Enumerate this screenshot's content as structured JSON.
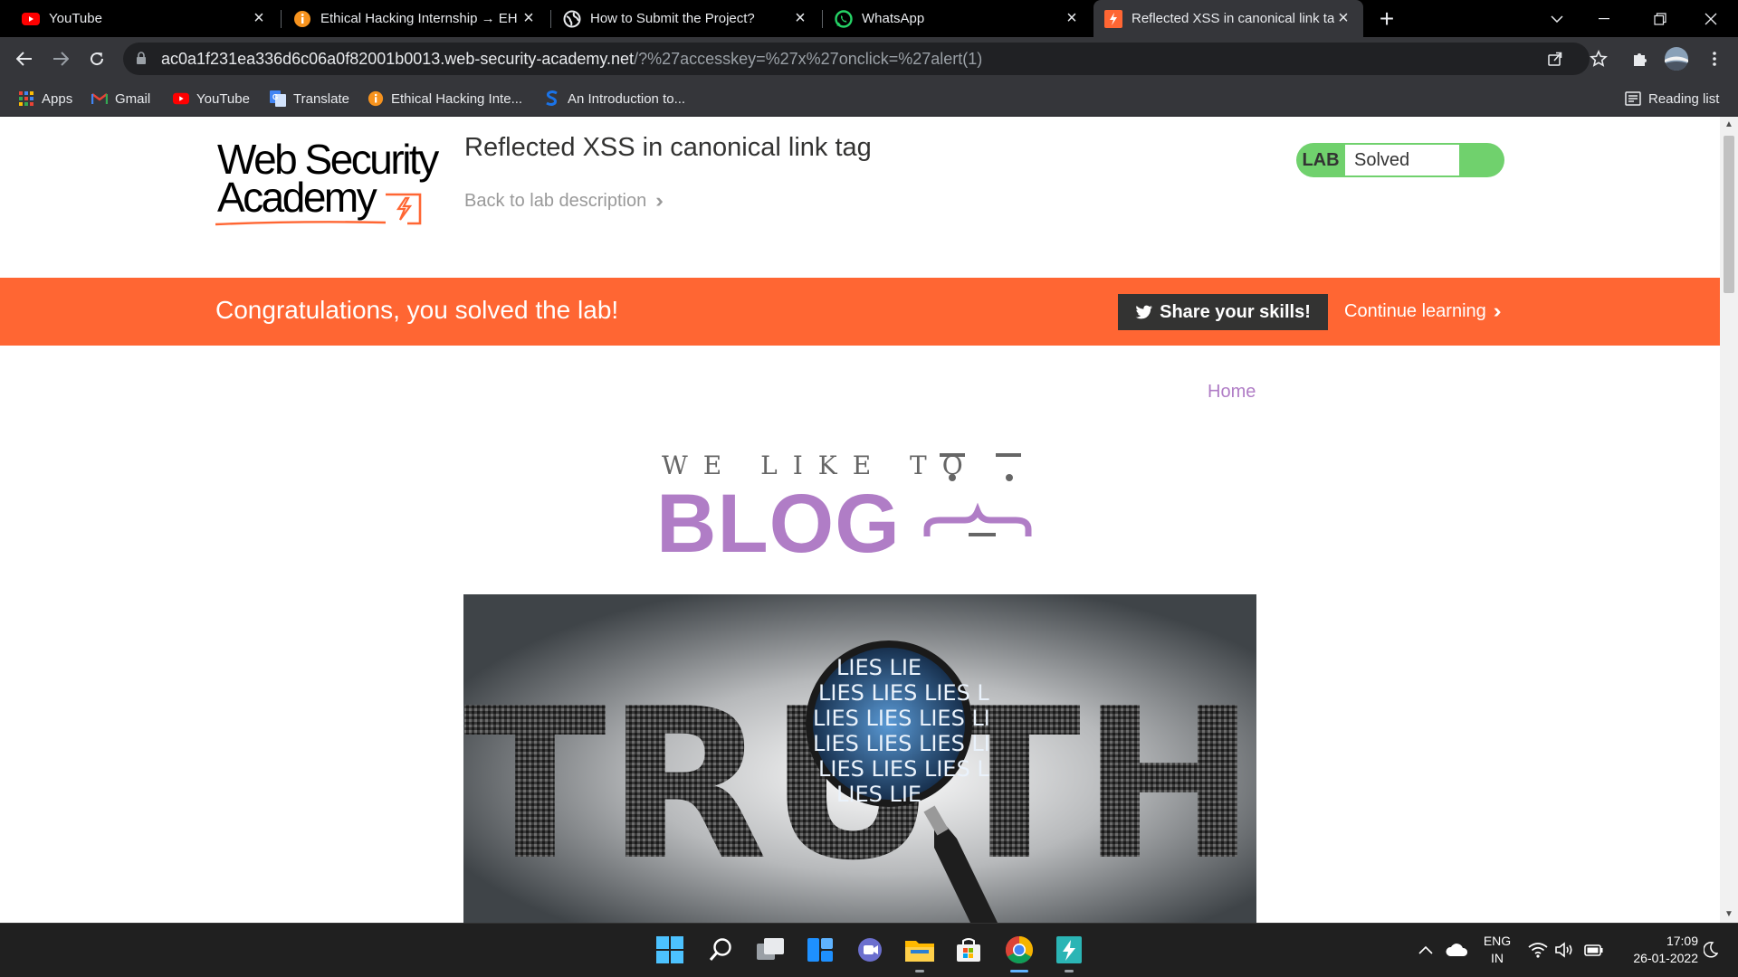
{
  "browser": {
    "tabs": [
      {
        "title": "YouTube",
        "favicon": "youtube-icon",
        "active": false
      },
      {
        "title": "Ethical Hacking Internship → EH I",
        "favicon": "orange-info-icon",
        "active": false
      },
      {
        "title": "How to Submit the Project?",
        "favicon": "globe-icon",
        "active": false
      },
      {
        "title": "WhatsApp",
        "favicon": "whatsapp-icon",
        "active": false
      },
      {
        "title": "Reflected XSS in canonical link ta",
        "favicon": "portswigger-icon",
        "active": true
      }
    ],
    "url_host": "ac0a1f231ea336d6c06a0f82001b0013.web-security-academy.net",
    "url_rest": "/?%27accesskey=%27x%27onclick=%27alert(1)",
    "bookmarks": [
      {
        "label": "Apps",
        "icon": "apps-grid-icon"
      },
      {
        "label": "Gmail",
        "icon": "gmail-icon"
      },
      {
        "label": "YouTube",
        "icon": "youtube-icon"
      },
      {
        "label": "Translate",
        "icon": "translate-icon"
      },
      {
        "label": "Ethical Hacking Inte...",
        "icon": "orange-info-icon"
      },
      {
        "label": "An Introduction to...",
        "icon": "s-logo-icon"
      }
    ],
    "reading_list": "Reading list"
  },
  "page": {
    "logo_line1": "Web Security",
    "logo_line2": "Academy",
    "lab_title": "Reflected XSS in canonical link tag",
    "back_link": "Back to lab description",
    "status_tag": "LAB",
    "status_value": "Solved",
    "banner_message": "Congratulations, you solved the lab!",
    "share_button": "Share your skills!",
    "continue_link": "Continue learning",
    "nav_home": "Home",
    "hero_small": "WE LIKE TO",
    "hero_big": "BLOG",
    "image_word": "TRUTH",
    "image_lens_text": [
      "LIES LIE",
      "LIES LIES LIES L",
      "LIES LIES LIES LI",
      "LIES LIES LIES LI",
      "LIES LIES LIES L",
      "LIES LIE"
    ]
  },
  "colors": {
    "banner": "#ff6633",
    "status_green": "#70d16d",
    "blog_purple": "#b07dc6"
  },
  "taskbar": {
    "apps": [
      "windows-start-icon",
      "search-icon",
      "task-view-icon",
      "widgets-icon",
      "teams-chat-icon",
      "file-explorer-icon",
      "microsoft-store-icon",
      "chrome-icon",
      "burp-suite-icon"
    ],
    "lang_line1": "ENG",
    "lang_line2": "IN",
    "time": "17:09",
    "date": "26-01-2022"
  }
}
